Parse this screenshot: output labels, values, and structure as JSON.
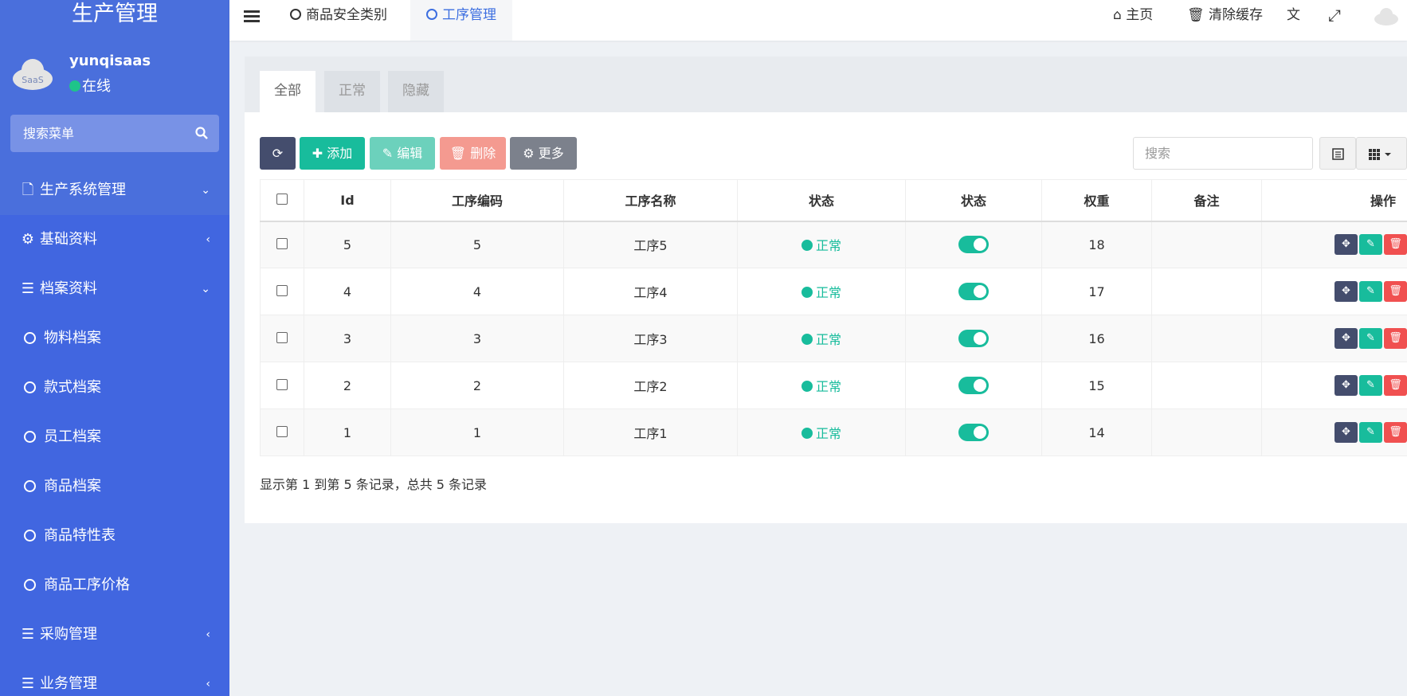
{
  "app": {
    "title": "生产管理"
  },
  "user": {
    "name": "yunqisaas",
    "status": "在线",
    "avatar_text": "SaaS"
  },
  "menu_search": {
    "placeholder": "搜索菜单"
  },
  "nav": {
    "items": [
      {
        "label": "生产系统管理",
        "icon": "file-icon",
        "caret": "chevron-down-icon"
      },
      {
        "label": "基础资料",
        "icon": "cogs-icon",
        "caret": "chevron-left-icon"
      },
      {
        "label": "档案资料",
        "icon": "list-icon",
        "caret": "chevron-down-icon"
      },
      {
        "label": "物料档案"
      },
      {
        "label": "款式档案"
      },
      {
        "label": "员工档案"
      },
      {
        "label": "商品档案"
      },
      {
        "label": "商品特性表"
      },
      {
        "label": "商品工序价格"
      },
      {
        "label": "采购管理",
        "icon": "list-icon",
        "caret": "chevron-left-icon"
      },
      {
        "label": "业务管理",
        "icon": "list-icon",
        "caret": "chevron-left-icon"
      }
    ]
  },
  "topbar": {
    "tabs": [
      {
        "label": "商品安全类别"
      },
      {
        "label": "工序管理"
      }
    ],
    "home_label": "主页",
    "clear_cache_label": "清除缓存"
  },
  "filter_tabs": [
    {
      "label": "全部"
    },
    {
      "label": "正常"
    },
    {
      "label": "隐藏"
    }
  ],
  "toolbar": {
    "add_label": "添加",
    "edit_label": "编辑",
    "delete_label": "删除",
    "more_label": "更多",
    "search_placeholder": "搜索"
  },
  "table": {
    "headers": [
      "Id",
      "工序编码",
      "工序名称",
      "状态",
      "状态",
      "权重",
      "备注",
      "操作"
    ],
    "rows": [
      {
        "id": "5",
        "code": "5",
        "name": "工序5",
        "status": "正常",
        "weight": "18",
        "remark": ""
      },
      {
        "id": "4",
        "code": "4",
        "name": "工序4",
        "status": "正常",
        "weight": "17",
        "remark": ""
      },
      {
        "id": "3",
        "code": "3",
        "name": "工序3",
        "status": "正常",
        "weight": "16",
        "remark": ""
      },
      {
        "id": "2",
        "code": "2",
        "name": "工序2",
        "status": "正常",
        "weight": "15",
        "remark": ""
      },
      {
        "id": "1",
        "code": "1",
        "name": "工序1",
        "status": "正常",
        "weight": "14",
        "remark": ""
      }
    ]
  },
  "pagination": {
    "summary": "显示第 1 到第 5 条记录，总共 5 条记录"
  },
  "colors": {
    "sidebar": "#4a6fdc",
    "success": "#18bc9c",
    "danger": "#f05050",
    "dark": "#444d6d"
  }
}
